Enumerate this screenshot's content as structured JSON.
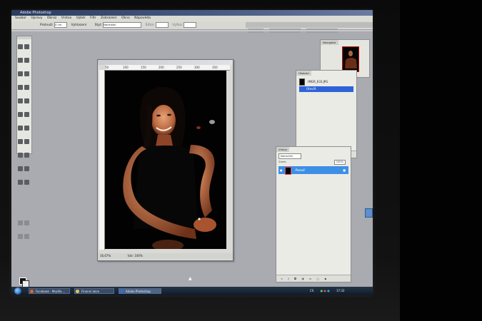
{
  "app": {
    "title": "Adobe Photoshop"
  },
  "menubar": {
    "items": [
      "Soubor",
      "Úpravy",
      "Obraz",
      "Vrstva",
      "Výběr",
      "Filtr",
      "Zobrazení",
      "Okno",
      "Nápověda"
    ]
  },
  "options": {
    "feather_label": "Prolnutí:",
    "feather_value": "0 cm",
    "antialias_label": "Vyhlazení",
    "style_label": "Styl:",
    "style_value": "Normální",
    "width_label": "Šířka:",
    "height_label": "Výška:"
  },
  "document": {
    "ruler_ticks": [
      "50",
      "100",
      "150",
      "200",
      "250",
      "300",
      "350"
    ],
    "zoom": "16,67%",
    "status": "Vzk: 100%"
  },
  "navigator": {
    "tab_label": "Navigator"
  },
  "history": {
    "tab_label": "Historie",
    "snapshot_label": "IMGR_633.JPG",
    "active_step": "Otevřít"
  },
  "layers": {
    "tab_label": "Vrstvy",
    "mode": "Normální",
    "lock_label": "Zamk:",
    "opacity": "100%",
    "layer_name": "Pozadí"
  },
  "taskbar": {
    "items": [
      {
        "label": "Facebook - Mozilla ...",
        "icon": "firefox-icon",
        "color": "#e0681c"
      },
      {
        "label": "Finanní akce",
        "icon": "folder-icon",
        "color": "#e8c25a"
      },
      {
        "label": "Adobe Photoshop",
        "icon": "photoshop-icon",
        "color": "#2e6fd1"
      }
    ],
    "lang": "CS",
    "clock": "17:32"
  },
  "colors": {
    "history_highlight": "#2f63d8",
    "layer_highlight": "#3d8fe6",
    "screen_bg": "#a9abb0"
  }
}
